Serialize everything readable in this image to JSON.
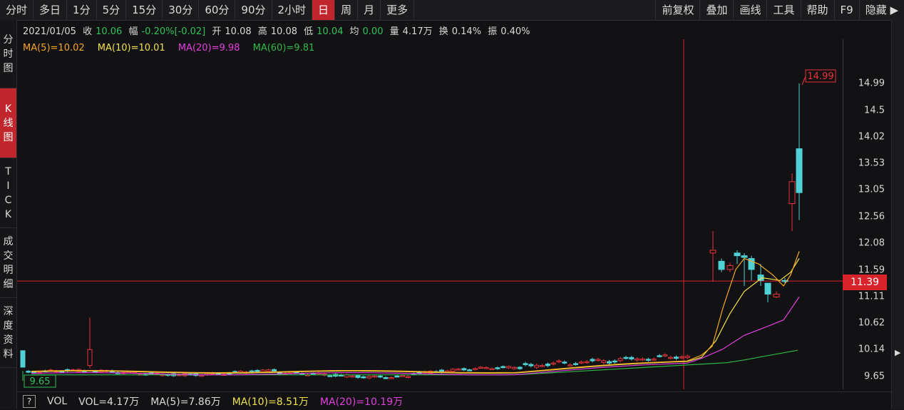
{
  "toolbar": {
    "periods": [
      "分时",
      "多日",
      "1分",
      "5分",
      "15分",
      "30分",
      "60分",
      "90分",
      "2小时",
      "日",
      "周",
      "月",
      "更多"
    ],
    "active_period": "日",
    "tools": [
      "前复权",
      "叠加",
      "画线",
      "工具",
      "帮助",
      "F9",
      "隐藏 ▶"
    ]
  },
  "sidebar": {
    "tabs": [
      "分时图",
      "K线图",
      "TICK",
      "成交明细",
      "深度资料"
    ],
    "active_tab": "K线图"
  },
  "info": {
    "date": "2021/01/05",
    "close_label": "收",
    "close": "10.06",
    "range_label": "幅",
    "range": "-0.20%[-0.02]",
    "open_label": "开",
    "open": "10.08",
    "high_label": "高",
    "high": "10.08",
    "low_label": "低",
    "low": "10.04",
    "avg_label": "均",
    "avg": "0.00",
    "vol_label": "量",
    "vol": "4.17万",
    "turnover_label": "换",
    "turnover": "0.14%",
    "amplitude_label": "振",
    "amplitude": "0.40%"
  },
  "ma": {
    "ma5": "MA(5)=10.02",
    "ma10": "MA(10)=10.01",
    "ma20": "MA(20)=9.98",
    "ma60": "MA(60)=9.81"
  },
  "price_axis": [
    "14.99",
    "14.5",
    "14.02",
    "13.53",
    "13.05",
    "12.56",
    "12.08",
    "11.59",
    "11.11",
    "10.62",
    "10.14",
    "9.65"
  ],
  "crosshair_price": "11.39",
  "max_label": "14.99",
  "min_label": "9.65",
  "volume": {
    "help": "?",
    "label": "VOL",
    "vol": "VOL=4.17万",
    "ma5": "MA(5)=7.86万",
    "ma10": "MA(10)=8.51万",
    "ma20": "MA(20)=10.19万"
  },
  "colors": {
    "up": "#e8343c",
    "down": "#4fd1d5",
    "ma5": "#f5a623",
    "ma10": "#f2e24a",
    "ma20": "#e23ee0",
    "ma60": "#2fb845",
    "green_text": "#2fc25b",
    "active": "#c0262c"
  }
}
